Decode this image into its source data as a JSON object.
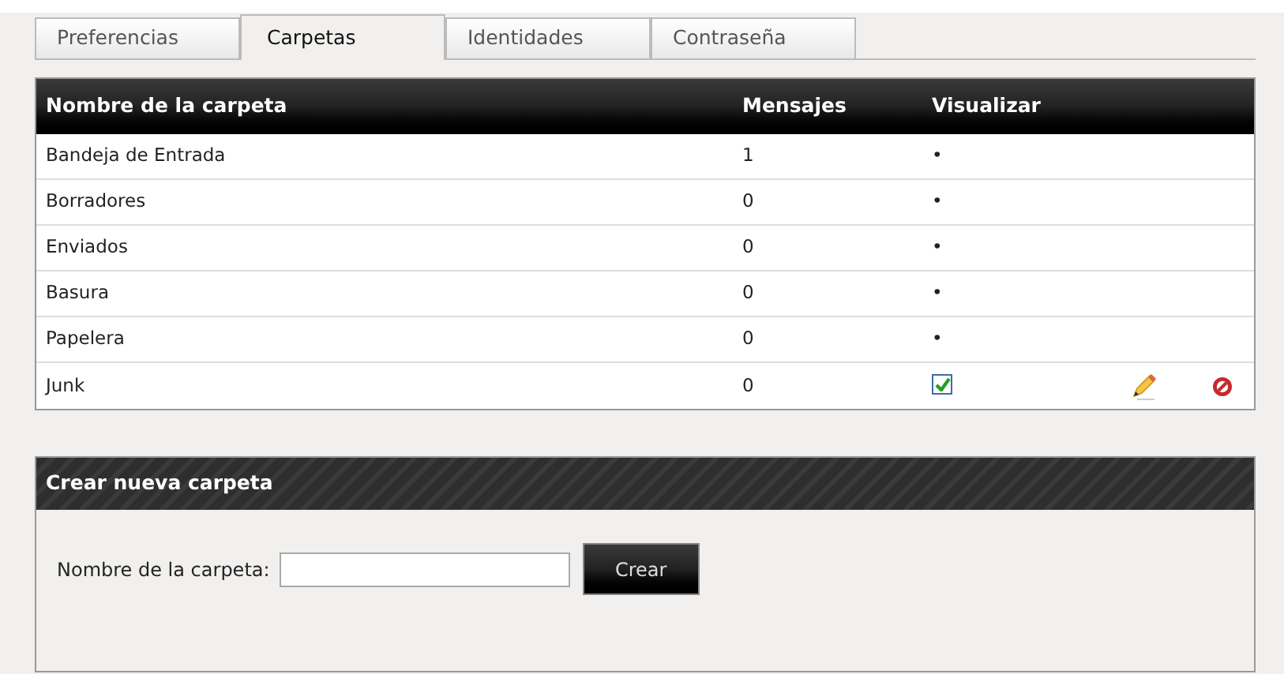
{
  "tabs": [
    {
      "label": "Preferencias",
      "selected": false
    },
    {
      "label": "Carpetas",
      "selected": true
    },
    {
      "label": "Identidades",
      "selected": false
    },
    {
      "label": "Contraseña",
      "selected": false
    }
  ],
  "folders_table": {
    "columns": [
      "Nombre de la carpeta",
      "Mensajes",
      "Visualizar"
    ],
    "rows": [
      {
        "name": "Bandeja de Entrada",
        "messages": "1",
        "display": {
          "kind": "bullet",
          "text": "•"
        },
        "editable": false
      },
      {
        "name": "Borradores",
        "messages": "0",
        "display": {
          "kind": "bullet",
          "text": "•"
        },
        "editable": false
      },
      {
        "name": "Enviados",
        "messages": "0",
        "display": {
          "kind": "bullet",
          "text": "•"
        },
        "editable": false
      },
      {
        "name": "Basura",
        "messages": "0",
        "display": {
          "kind": "bullet",
          "text": "•"
        },
        "editable": false
      },
      {
        "name": "Papelera",
        "messages": "0",
        "display": {
          "kind": "bullet",
          "text": "•"
        },
        "editable": false
      },
      {
        "name": "Junk",
        "messages": "0",
        "display": {
          "kind": "checkbox",
          "checked": true
        },
        "editable": true
      }
    ]
  },
  "new_folder": {
    "title": "Crear nueva carpeta",
    "label": "Nombre de la carpeta:",
    "button": "Crear"
  }
}
